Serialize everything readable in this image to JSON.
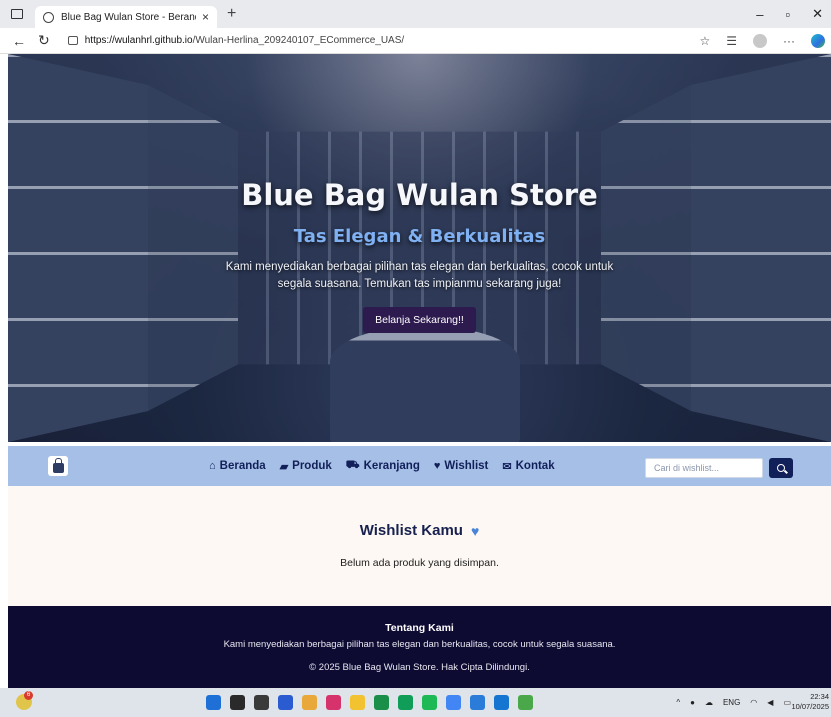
{
  "browser": {
    "tab_title": "Blue Bag Wulan Store - Beranda",
    "tab_close": "×",
    "new_tab": "+",
    "url_host": "https://wulanhrl.github.io",
    "url_path": "/Wulan-Herlina_209240107_ECommerce_UAS/",
    "window_controls": [
      "–",
      "▫",
      "✕"
    ]
  },
  "hero": {
    "title": "Blue Bag Wulan Store",
    "subtitle": "Tas Elegan & Berkualitas",
    "description": "Kami menyediakan berbagai pilihan tas elegan dan berkualitas, cocok untuk segala suasana. Temukan tas impianmu sekarang juga!",
    "cta_label": "Belanja Sekarang!!"
  },
  "navbar": {
    "links": [
      {
        "label": "Beranda",
        "icon": "home-icon"
      },
      {
        "label": "Produk",
        "icon": "bag-icon"
      },
      {
        "label": "Keranjang",
        "icon": "cart-icon"
      },
      {
        "label": "Wishlist",
        "icon": "heart-icon"
      },
      {
        "label": "Kontak",
        "icon": "envelope-icon"
      }
    ],
    "search_placeholder": "Cari di wishlist..."
  },
  "wishlist": {
    "title": "Wishlist Kamu",
    "empty_message": "Belum ada produk yang disimpan."
  },
  "footer": {
    "title": "Tentang Kami",
    "description": "Kami menyediakan berbagai pilihan tas elegan dan berkualitas, cocok untuk segala suasana.",
    "copyright": "© 2025 Blue Bag Wulan Store. Hak Cipta Dilindungi."
  },
  "taskbar": {
    "badge": "6",
    "language": "ENG",
    "time": "22:34",
    "date": "10/07/2025",
    "app_colors": [
      "#1e6fd6",
      "#2a2a2a",
      "#3a3a3a",
      "#2b5bd0",
      "#e8a93a",
      "#d6336c",
      "#f2c230",
      "#1a8f4a",
      "#0f9d58",
      "#1db954",
      "#4285f4",
      "#2b7bd8",
      "#1576d1",
      "#4aa84a"
    ]
  },
  "colors": {
    "navbar_bg": "#a6bfe6",
    "nav_text": "#12205a",
    "cta_bg": "#2d1a4f",
    "footer_bg": "#0e0b33",
    "wishlist_bg": "#fdf8f3",
    "subtitle": "#7fb0f2"
  }
}
